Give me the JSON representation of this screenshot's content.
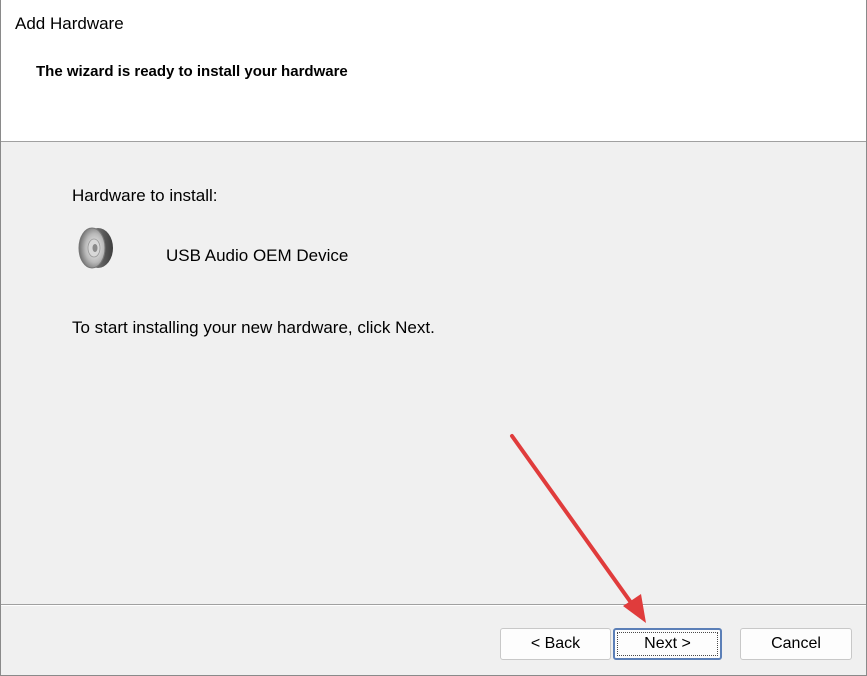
{
  "window": {
    "title": "Add Hardware"
  },
  "header": {
    "heading": "The wizard is ready to install your hardware"
  },
  "content": {
    "section_label": "Hardware to install:",
    "device_name": "USB Audio OEM Device",
    "device_icon": "speaker-icon",
    "instruction": "To start installing your new hardware, click Next."
  },
  "buttons": {
    "back_label": "< Back",
    "next_label": "Next >",
    "cancel_label": "Cancel"
  },
  "annotation": {
    "arrow_color": "#e03c3c",
    "target": "next-button"
  }
}
